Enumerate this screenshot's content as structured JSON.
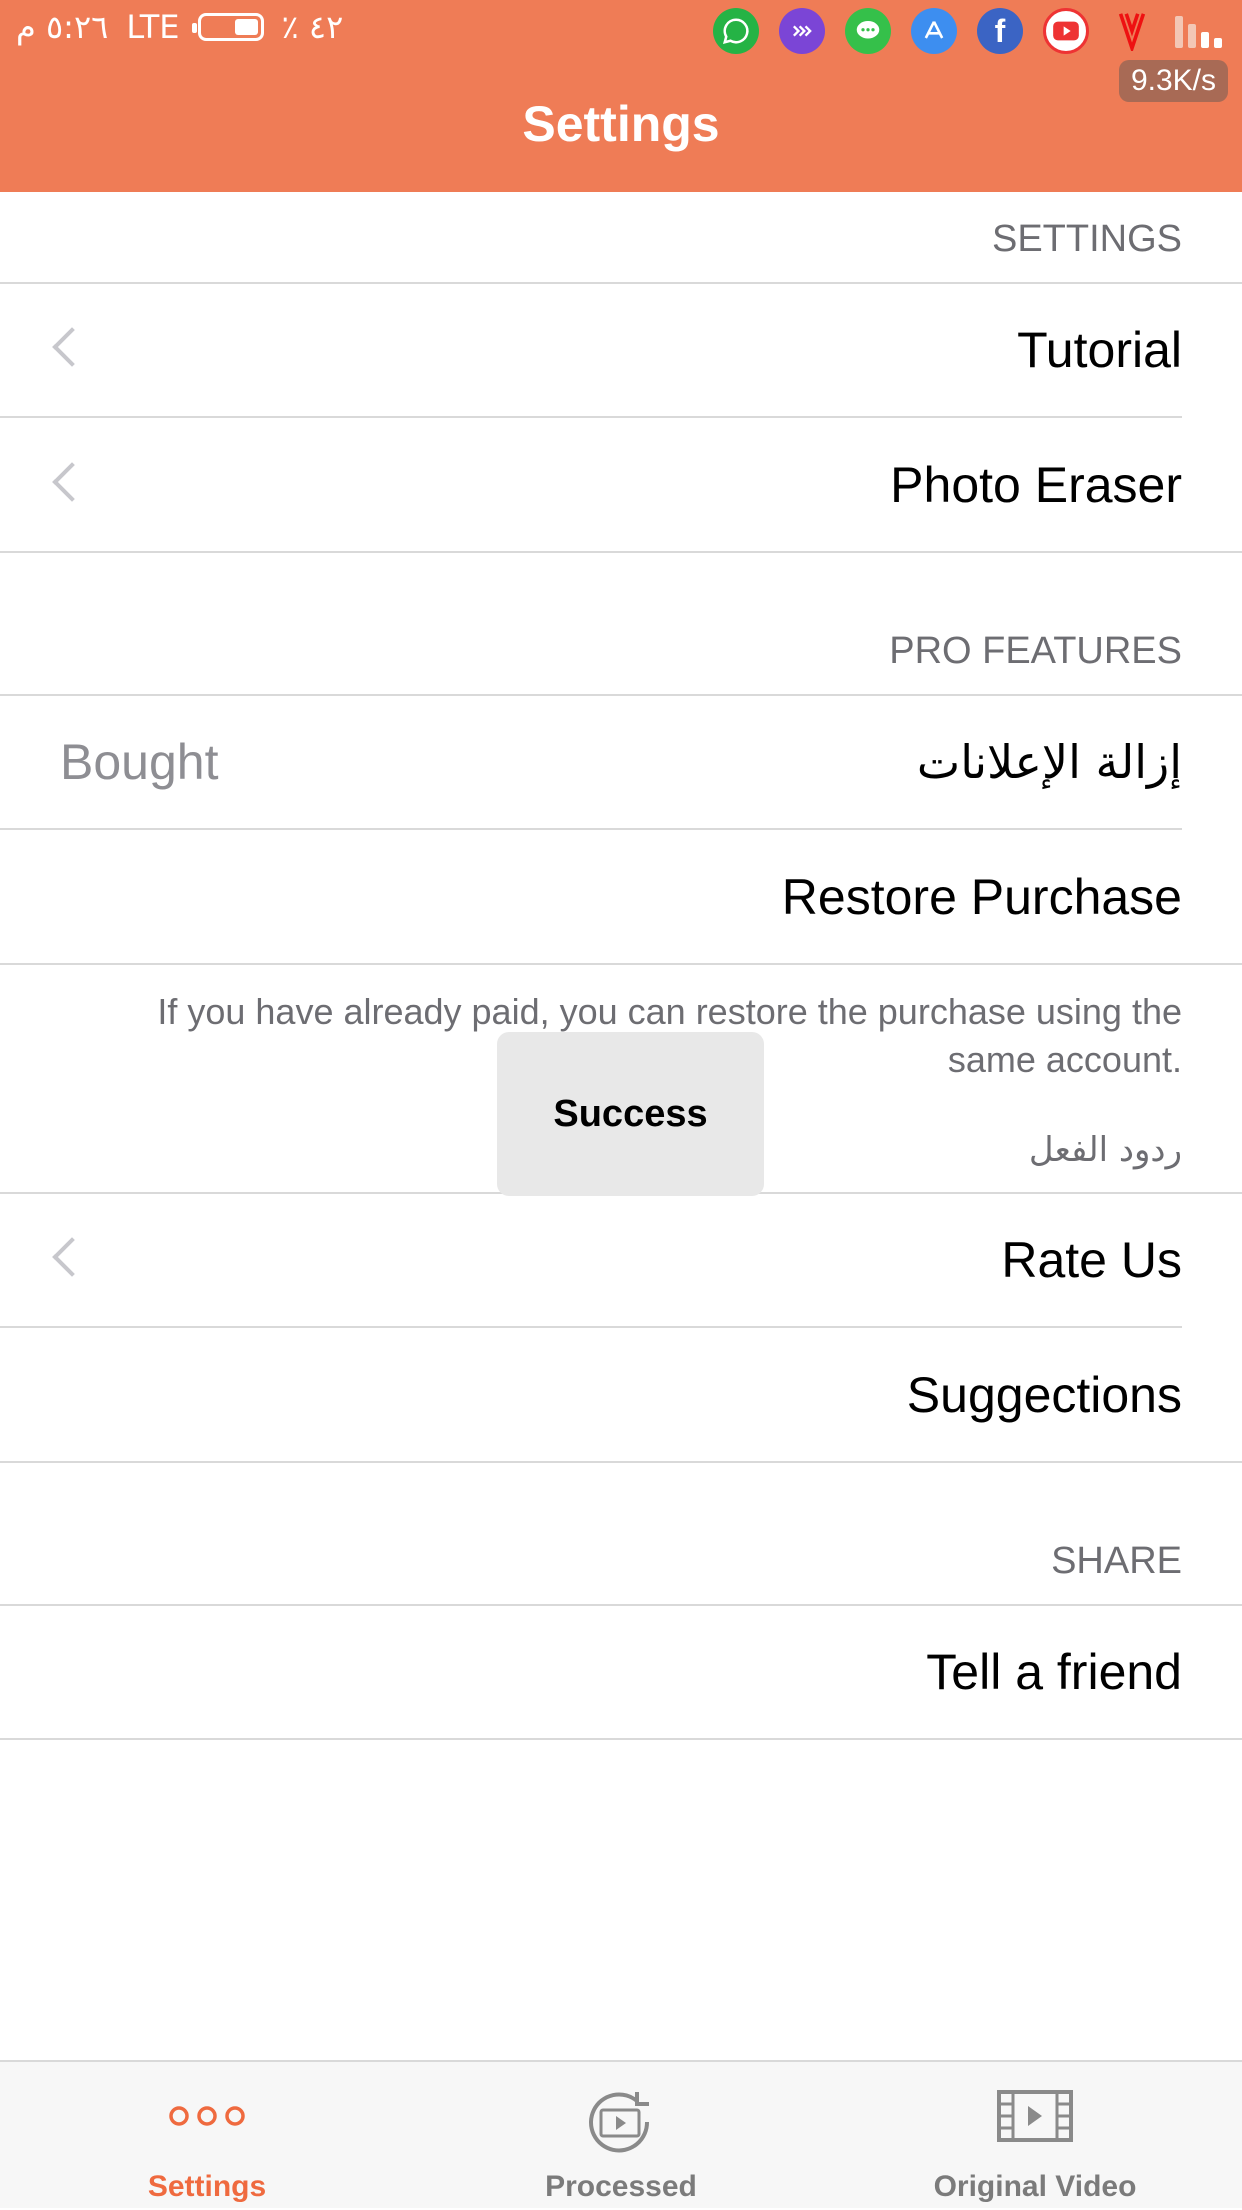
{
  "status_bar": {
    "time": "٥:٢٦ م",
    "network": "LTE",
    "battery_percent": "٪ ٤٢",
    "battery_level": 0.42,
    "net_speed": "9.3K/s",
    "app_icons": [
      "whatsapp-icon",
      "messenger-bot-icon",
      "messages-icon",
      "app-store-icon",
      "facebook-icon",
      "youtube-icon",
      "vodafone-icon"
    ]
  },
  "header": {
    "title": "Settings"
  },
  "sections": {
    "settings": {
      "header": "SETTINGS",
      "items": [
        {
          "label": "Tutorial"
        },
        {
          "label": "Photo Eraser"
        }
      ]
    },
    "pro": {
      "header": "PRO FEATURES",
      "remove_ads_label": "إزالة الإعلانات",
      "remove_ads_value": "Bought",
      "restore_label": "Restore Purchase",
      "note": "If you have already paid, you can restore the purchase using the same account."
    },
    "feedback": {
      "header": "ردود الفعل",
      "items": [
        {
          "label": "Rate Us"
        },
        {
          "label": "Suggections"
        }
      ]
    },
    "share": {
      "header": "SHARE",
      "items": [
        {
          "label": "Tell a friend"
        }
      ]
    }
  },
  "toast": {
    "text": "Success"
  },
  "tabs": [
    {
      "label": "Settings",
      "active": true
    },
    {
      "label": "Processed",
      "active": false
    },
    {
      "label": "Original Video",
      "active": false
    }
  ],
  "colors": {
    "accent": "#ef7c56",
    "active_tab": "#ef6a3f",
    "section_text": "#6d6d72"
  }
}
